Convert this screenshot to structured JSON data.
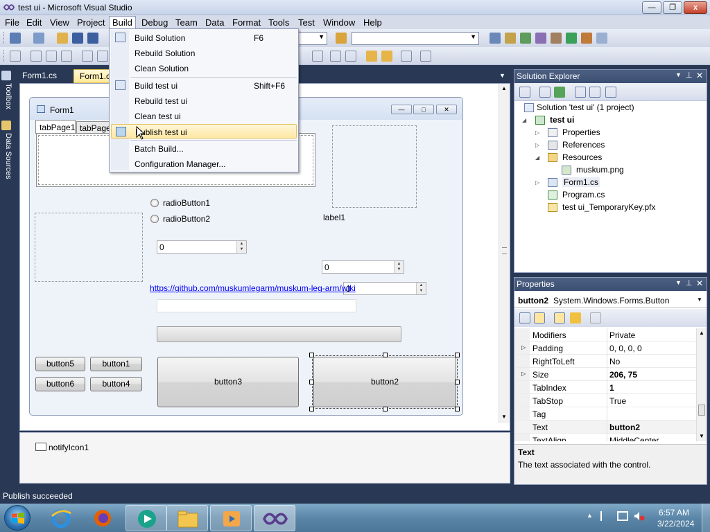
{
  "window": {
    "title": "test ui - Microsoft Visual Studio",
    "min": "‒",
    "max": "❐",
    "close": "x"
  },
  "menubar": [
    "File",
    "Edit",
    "View",
    "Project",
    "Build",
    "Debug",
    "Team",
    "Data",
    "Format",
    "Tools",
    "Test",
    "Window",
    "Help"
  ],
  "build_menu": {
    "items": [
      {
        "label": "Build Solution",
        "shortcut": "F6"
      },
      {
        "label": "Rebuild Solution",
        "shortcut": ""
      },
      {
        "label": "Clean Solution",
        "shortcut": ""
      },
      {
        "label": "Build test ui",
        "shortcut": "Shift+F6"
      },
      {
        "label": "Rebuild test ui",
        "shortcut": ""
      },
      {
        "label": "Clean test ui",
        "shortcut": ""
      },
      {
        "label": "Publish test ui",
        "shortcut": ""
      },
      {
        "label": "Batch Build...",
        "shortcut": ""
      },
      {
        "label": "Configuration Manager...",
        "shortcut": ""
      }
    ]
  },
  "left_strip": {
    "toolbox": "Toolbox",
    "datasources": "Data Sources"
  },
  "doc_tabs": [
    "Form1.cs",
    "Form1.cs"
  ],
  "form": {
    "title": "Form1",
    "tab1": "tabPage1",
    "tab2": "tabPage",
    "radio1": "radioButton1",
    "radio2": "radioButton2",
    "label1": "label1",
    "num1": "0",
    "num2": "0",
    "num3": "0",
    "link": "https://github.com/muskumlegarm/muskum-leg-arm/wiki",
    "button5": "button5",
    "button1": "button1",
    "button6": "button6",
    "button4": "button4",
    "button3": "button3",
    "button2": "button2"
  },
  "tray_component": "notifyIcon1",
  "solution_explorer": {
    "title": "Solution Explorer",
    "nodes": {
      "solution": "Solution 'test ui' (1 project)",
      "project": "test ui",
      "properties": "Properties",
      "references": "References",
      "resources": "Resources",
      "png": "muskum.png",
      "form1": "Form1.cs",
      "program": "Program.cs",
      "pfx": "test ui_TemporaryKey.pfx"
    }
  },
  "properties": {
    "title": "Properties",
    "object": "button2",
    "object_type": "System.Windows.Forms.Button",
    "rows": [
      {
        "name": "Modifiers",
        "value": "Private",
        "bold": false
      },
      {
        "name": "Padding",
        "value": "0, 0, 0, 0",
        "bold": false
      },
      {
        "name": "RightToLeft",
        "value": "No",
        "bold": false
      },
      {
        "name": "Size",
        "value": "206, 75",
        "bold": true
      },
      {
        "name": "TabIndex",
        "value": "1",
        "bold": true
      },
      {
        "name": "TabStop",
        "value": "True",
        "bold": false
      },
      {
        "name": "Tag",
        "value": "",
        "bold": false
      },
      {
        "name": "Text",
        "value": "button2",
        "bold": true
      },
      {
        "name": "TextAlign",
        "value": "MiddleCenter",
        "bold": false
      }
    ],
    "desc_title": "Text",
    "desc_text": "The text associated with the control."
  },
  "status": "Publish succeeded",
  "clock": {
    "time": "6:57 AM",
    "date": "3/22/2024"
  },
  "colors": {
    "accent": "#293955",
    "menu_highlight": "#ffe7a3",
    "pane_header": "#3b4f73"
  }
}
